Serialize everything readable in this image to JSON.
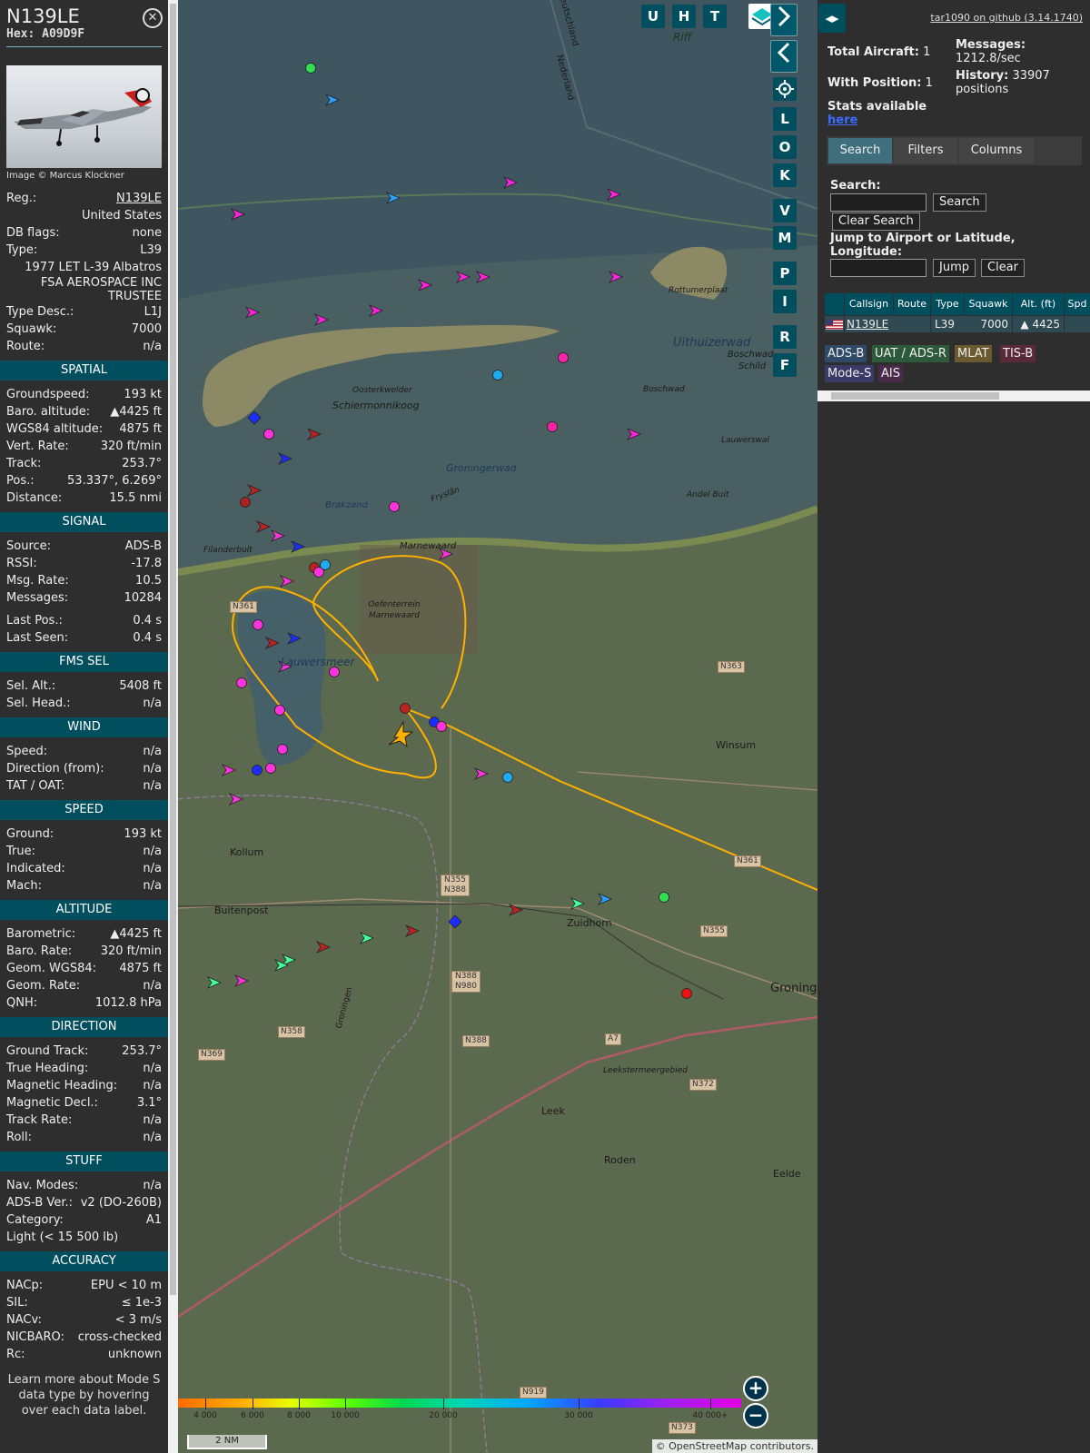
{
  "aircraft": {
    "callsign": "N139LE",
    "hex_label": "Hex: A09D9F",
    "photo_credit": "Image © Marcus Klockner",
    "rows": [
      {
        "k": "Reg.:",
        "v": "N139LE",
        "link": true
      },
      {
        "k": "",
        "v": "United States"
      },
      {
        "k": "DB flags:",
        "v": "none"
      },
      {
        "k": "Type:",
        "v": "L39"
      },
      {
        "k": "",
        "v": "1977 LET L-39 Albatros"
      },
      {
        "k": "",
        "v": "FSA AEROSPACE INC TRUSTEE",
        "wrap": true
      },
      {
        "k": "Type Desc.:",
        "v": "L1J"
      },
      {
        "k": "Squawk:",
        "v": "7000"
      },
      {
        "k": "Route:",
        "v": "n/a"
      }
    ]
  },
  "sections": [
    {
      "title": "SPATIAL",
      "rows": [
        {
          "k": "Groundspeed:",
          "v": "193 kt"
        },
        {
          "k": "Baro. altitude:",
          "v": "▲4425 ft"
        },
        {
          "k": "WGS84 altitude:",
          "v": "4875 ft"
        },
        {
          "k": "Vert. Rate:",
          "v": "320 ft/min"
        },
        {
          "k": "Track:",
          "v": "253.7°"
        },
        {
          "k": "Pos.:",
          "v": "53.337°, 6.269°"
        },
        {
          "k": "Distance:",
          "v": "15.5 nmi"
        }
      ]
    },
    {
      "title": "SIGNAL",
      "rows": [
        {
          "k": "Source:",
          "v": "ADS-B"
        },
        {
          "k": "RSSI:",
          "v": "-17.8"
        },
        {
          "k": "Msg. Rate:",
          "v": "10.5"
        },
        {
          "k": "Messages:",
          "v": "10284"
        },
        {
          "k": "Last Pos.:",
          "v": "0.4 s",
          "gap": true
        },
        {
          "k": "Last Seen:",
          "v": "0.4 s"
        }
      ]
    },
    {
      "title": "FMS SEL",
      "rows": [
        {
          "k": "Sel. Alt.:",
          "v": "5408 ft"
        },
        {
          "k": "Sel. Head.:",
          "v": "n/a"
        }
      ]
    },
    {
      "title": "WIND",
      "rows": [
        {
          "k": "Speed:",
          "v": "n/a"
        },
        {
          "k": "Direction (from):",
          "v": "n/a"
        },
        {
          "k": "TAT / OAT:",
          "v": "n/a"
        }
      ]
    },
    {
      "title": "SPEED",
      "rows": [
        {
          "k": "Ground:",
          "v": "193 kt"
        },
        {
          "k": "True:",
          "v": "n/a"
        },
        {
          "k": "Indicated:",
          "v": "n/a"
        },
        {
          "k": "Mach:",
          "v": "n/a"
        }
      ]
    },
    {
      "title": "ALTITUDE",
      "rows": [
        {
          "k": "Barometric:",
          "v": "▲4425 ft"
        },
        {
          "k": "Baro. Rate:",
          "v": "320 ft/min"
        },
        {
          "k": "Geom. WGS84:",
          "v": "4875 ft"
        },
        {
          "k": "Geom. Rate:",
          "v": "n/a"
        },
        {
          "k": "QNH:",
          "v": "1012.8 hPa"
        }
      ]
    },
    {
      "title": "DIRECTION",
      "rows": [
        {
          "k": "Ground Track:",
          "v": "253.7°"
        },
        {
          "k": "True Heading:",
          "v": "n/a"
        },
        {
          "k": "Magnetic Heading:",
          "v": "n/a"
        },
        {
          "k": "Magnetic Decl.:",
          "v": "3.1°"
        },
        {
          "k": "Track Rate:",
          "v": "n/a"
        },
        {
          "k": "Roll:",
          "v": "n/a"
        }
      ]
    },
    {
      "title": "STUFF",
      "rows": [
        {
          "k": "Nav. Modes:",
          "v": "n/a"
        },
        {
          "k": "ADS-B Ver.:",
          "v": "v2 (DO-260B)"
        },
        {
          "k": "Category:",
          "v": "A1"
        },
        {
          "k": "Light (< 15 500 lb)",
          "v": ""
        }
      ]
    },
    {
      "title": "ACCURACY",
      "rows": [
        {
          "k": "NACp:",
          "v": "EPU < 10 m"
        },
        {
          "k": "SIL:",
          "v": "≤ 1e-3"
        },
        {
          "k": "NACv:",
          "v": "< 3 m/s"
        },
        {
          "k": "NICBARO:",
          "v": "cross-checked"
        },
        {
          "k": "Rc:",
          "v": "unknown"
        }
      ]
    }
  ],
  "learn_more": "Learn more about Mode S data type by hovering over each data label.",
  "map": {
    "buttons_top": [
      "U",
      "H",
      "T"
    ],
    "buttons_side": [
      "L",
      "O",
      "K",
      "V",
      "M",
      "P",
      "I",
      "R",
      "F"
    ],
    "labels": {
      "schiermonnikoog": "Schiermonnikoog",
      "oosterkwelder": "Oosterkwelder",
      "rottumerplaat": "Rottumerplaat",
      "uithuizerwad": "Uithuizerwad",
      "boschwad": "Boschwad-Schild",
      "groningerwad": "Groningerwad",
      "brakzand": "Brakzand",
      "frysl": "Fryslân",
      "marnewaard": "Marnewaard",
      "oefenterrein": "Oefenterrein Marnewaard",
      "lauwersmeer": "Lauwersmeer",
      "filanderbult": "Filanderbult",
      "winsum": "Winsum",
      "kollum": "Kollum",
      "buitenpost": "Buitenpost",
      "zuidhorn": "Zuidhorn",
      "leek": "Leek",
      "roden": "Roden",
      "eelde": "Eelde",
      "groning": "Groning",
      "leekster": "Leekstermeergebied",
      "riff": "Riff",
      "andelbuit": "Andel Buit",
      "lauwerswal": "Lauwerswal",
      "nederland": "Nederland",
      "deutschland": "Deutschland",
      "groningen": "Groningen",
      "boschwad2": "Boschwad"
    },
    "roads": [
      "N361",
      "N363",
      "N361",
      "N355 N388",
      "N355",
      "N388 N980",
      "N358",
      "N369",
      "N388",
      "A7",
      "N372",
      "N919",
      "N373"
    ],
    "altitude_scale": [
      "4 000",
      "6 000",
      "8 000",
      "10 000",
      "20 000",
      "30 000",
      "40 000+"
    ],
    "scale_label": "2 NM",
    "attribution": "© OpenStreetMap contributors."
  },
  "right": {
    "version": "tar1090 on github (3.14.1740)",
    "total_aircraft_label": "Total Aircraft:",
    "total_aircraft": "1",
    "with_position_label": "With Position:",
    "with_position": "1",
    "messages_label": "Messages:",
    "messages": "1212.8/sec",
    "history_label": "History:",
    "history": "33907 positions",
    "stats_label": "Stats available",
    "stats_link": "here",
    "tabs": [
      "Search",
      "Filters",
      "Columns"
    ],
    "search_label": "Search:",
    "search_btn": "Search",
    "clear_search_btn": "Clear Search",
    "jump_label": "Jump to Airport or Latitude, Longitude:",
    "jump_btn": "Jump",
    "clear_btn": "Clear",
    "table_headers": [
      "",
      "Callsign",
      "Route",
      "Type",
      "Squawk",
      "Alt. (ft)",
      "Spd"
    ],
    "table_row": {
      "callsign": "N139LE",
      "route": "",
      "type": "L39",
      "squawk": "7000",
      "alt": "▲ 4425",
      "spd": ""
    },
    "badges": [
      {
        "label": "ADS-B",
        "bg": "#2f4a66"
      },
      {
        "label": "UAT / ADS-R",
        "bg": "#2d5a3b"
      },
      {
        "label": "MLAT",
        "bg": "#6b5a2e"
      },
      {
        "label": "TIS-B",
        "bg": "#5a2a3a"
      },
      {
        "label": "Mode-S",
        "bg": "#3a3a66"
      },
      {
        "label": "AIS",
        "bg": "#4a2a4a"
      }
    ]
  }
}
